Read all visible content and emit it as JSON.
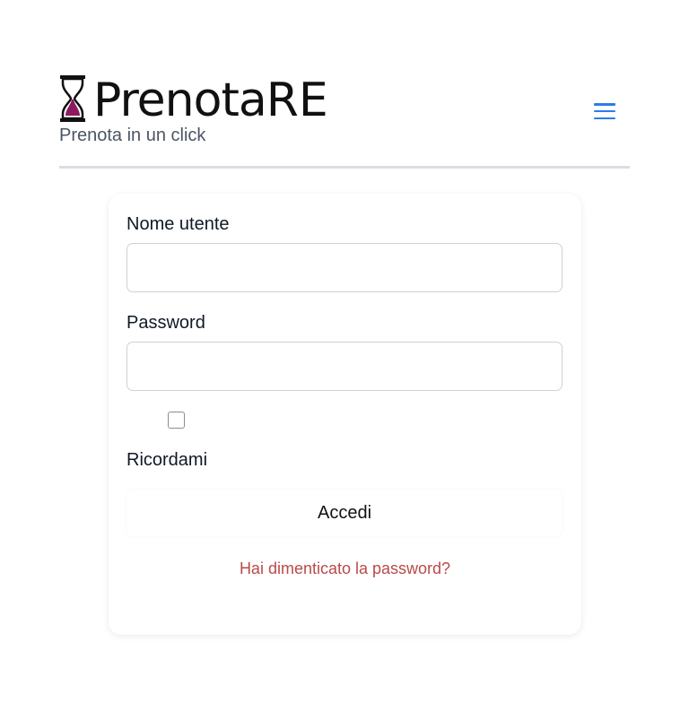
{
  "header": {
    "brand_name": "Prenota",
    "brand_suffix": "RE",
    "tagline": "Prenota in un click",
    "menu_icon": "hamburger-menu-icon",
    "accent_color": "#2b7de9",
    "logo_accent_color": "#8b1a5e"
  },
  "login_form": {
    "username_label": "Nome utente",
    "username_value": "",
    "password_label": "Password",
    "password_value": "",
    "remember_label": "Ricordami",
    "remember_checked": false,
    "submit_label": "Accedi",
    "forgot_password_label": "Hai dimenticato la password?",
    "link_color": "#b94a48"
  }
}
